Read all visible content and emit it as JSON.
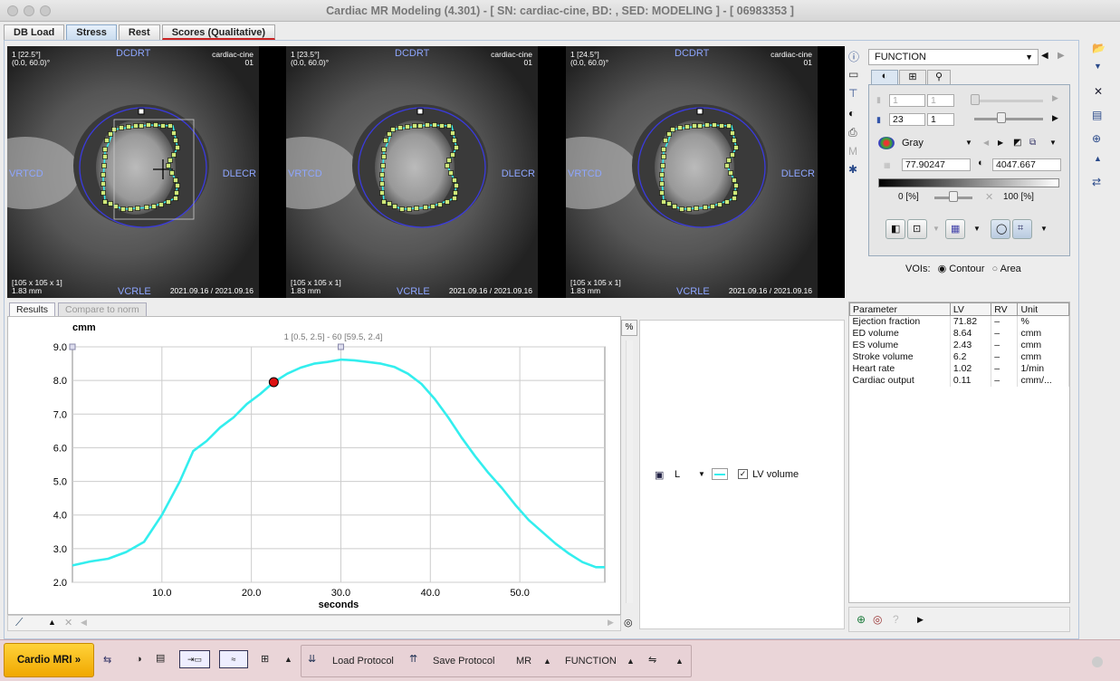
{
  "window": {
    "title": "Cardiac MR Modeling (4.301) - [ SN: cardiac-cine, BD: , SED: MODELING ] - [ 06983353 ]"
  },
  "tabs": [
    {
      "label": "DB Load"
    },
    {
      "label": "Stress"
    },
    {
      "label": "Rest"
    },
    {
      "label": "Scores (Qualitative)"
    }
  ],
  "viewers": [
    {
      "slice": "1 [22.5°]",
      "coord": "(0.0, 60.0)°",
      "top": "DCDRT",
      "bottom": "VCRLE",
      "left": "VRTCD",
      "right": "DLECR",
      "study": "cardiac-cine",
      "series": "01",
      "dims": "[105 x 105 x 1]",
      "pixel": "1.83 mm",
      "dates": "2021.09.16 / 2021.09.16"
    },
    {
      "slice": "1 [23.5°]",
      "coord": "(0.0, 60.0)°",
      "top": "DCDRT",
      "bottom": "VCRLE",
      "left": "VRTCD",
      "right": "DLECR",
      "study": "cardiac-cine",
      "series": "01",
      "dims": "[105 x 105 x 1]",
      "pixel": "1.83 mm",
      "dates": "2021.09.16 / 2021.09.16"
    },
    {
      "slice": "1 [24.5°]",
      "coord": "(0.0, 60.0)°",
      "top": "DCDRT",
      "bottom": "VCRLE",
      "left": "VRTCD",
      "right": "DLECR",
      "study": "cardiac-cine",
      "series": "01",
      "dims": "[105 x 105 x 1]",
      "pixel": "1.83 mm",
      "dates": "2021.09.16 / 2021.09.16"
    }
  ],
  "panel": {
    "mode": "FUNCTION",
    "frame_a": "1",
    "frame_b": "1",
    "slice_a": "23",
    "slice_b": "1",
    "colormap": "Gray",
    "min": "77.90247",
    "max": "4047.667",
    "pct_min": "0 [%]",
    "pct_max": "100 [%]",
    "pct_min_frac": 0,
    "pct_max_frac": 1,
    "vois_label": "VOIs:",
    "contour": "Contour",
    "area": "Area",
    "selected": "contour"
  },
  "results_tabs": [
    {
      "label": "Results"
    },
    {
      "label": "Compare to norm"
    }
  ],
  "chart_data": {
    "type": "line",
    "ylabel": "cmm",
    "xlabel": "seconds",
    "annotation": "1 [0.5, 2.5] - 60 [59.5, 2.4]",
    "xlim": [
      0,
      59.5
    ],
    "ylim": [
      2.0,
      9.0
    ],
    "xticks": [
      10.0,
      20.0,
      30.0,
      40.0,
      50.0
    ],
    "yticks": [
      2.0,
      3.0,
      4.0,
      5.0,
      6.0,
      7.0,
      8.0,
      9.0
    ],
    "xtick_labels": [
      "10.0",
      "20.0",
      "30.0",
      "40.0",
      "50.0"
    ],
    "ytick_labels": [
      "2.0",
      "3.0",
      "4.0",
      "5.0",
      "6.0",
      "7.0",
      "8.0",
      "9.0"
    ],
    "grid": true,
    "series": [
      {
        "name": "LV volume",
        "color": "#33eeee",
        "x": [
          0,
          2,
          4,
          6,
          8,
          10,
          12,
          13.5,
          15,
          16.5,
          18,
          19.5,
          21,
          22.5,
          24,
          25.5,
          27,
          28.5,
          30,
          31.5,
          33,
          34.5,
          36,
          37.5,
          39,
          40.5,
          42,
          43.5,
          45,
          46.5,
          48,
          49.5,
          51,
          52.5,
          54,
          55.5,
          57,
          58.5,
          59.5
        ],
        "y": [
          2.5,
          2.62,
          2.7,
          2.9,
          3.2,
          4.0,
          5.0,
          5.9,
          6.2,
          6.6,
          6.9,
          7.3,
          7.6,
          7.95,
          8.2,
          8.38,
          8.5,
          8.55,
          8.62,
          8.6,
          8.55,
          8.5,
          8.4,
          8.2,
          7.9,
          7.45,
          6.9,
          6.3,
          5.75,
          5.25,
          4.8,
          4.3,
          3.85,
          3.5,
          3.15,
          2.85,
          2.6,
          2.45,
          2.45
        ]
      }
    ],
    "marker": {
      "x": 22.5,
      "y": 7.95,
      "color": "#dd1111"
    }
  },
  "legend": {
    "label": "L",
    "series": "LV volume",
    "pct_button": "%"
  },
  "params": {
    "headers": [
      "Parameter",
      "LV",
      "RV",
      "Unit"
    ],
    "rows": [
      [
        "Ejection fraction",
        "71.82",
        "–",
        "%"
      ],
      [
        "ED volume",
        "8.64",
        "–",
        "cmm"
      ],
      [
        "ES volume",
        "2.43",
        "–",
        "cmm"
      ],
      [
        "Stroke volume",
        "6.2",
        "–",
        "cmm"
      ],
      [
        "Heart rate",
        "1.02",
        "–",
        "1/min"
      ],
      [
        "Cardiac output",
        "0.11",
        "–",
        "cmm/..."
      ]
    ]
  },
  "toolbar": {
    "app": "Cardio MRI »",
    "load": "Load Protocol",
    "save": "Save Protocol",
    "mr": "MR",
    "function": "FUNCTION"
  }
}
